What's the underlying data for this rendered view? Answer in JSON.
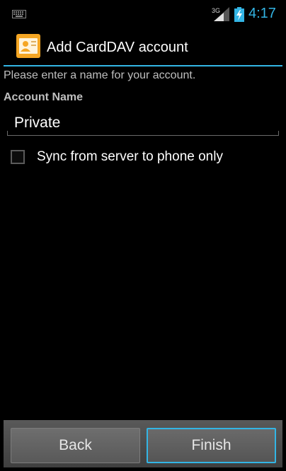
{
  "status_bar": {
    "network_type": "3G",
    "clock": "4:17",
    "icons": [
      "keyboard-icon",
      "signal-icon",
      "battery-charging-icon"
    ]
  },
  "header": {
    "title": "Add CardDAV account",
    "icon": "contact-card-icon"
  },
  "form": {
    "hint": "Please enter a name for your account.",
    "account_name_label": "Account Name",
    "account_name_value": "Private",
    "sync_option_label": "Sync from server to phone only",
    "sync_option_checked": false
  },
  "buttons": {
    "back_label": "Back",
    "finish_label": "Finish"
  },
  "colors": {
    "accent": "#33b5e5",
    "background": "#000000",
    "icon_orange": "#f5a623"
  }
}
